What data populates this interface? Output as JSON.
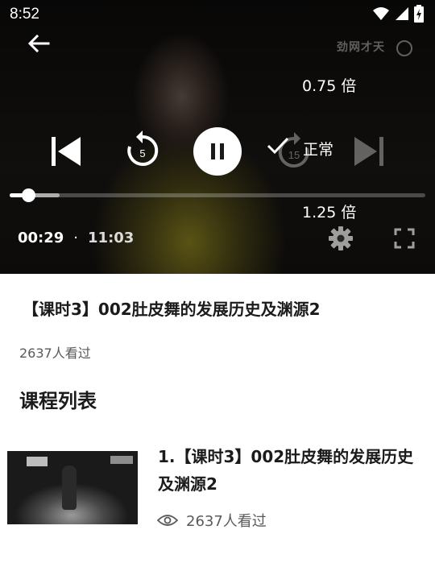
{
  "status_bar": {
    "time": "8:52"
  },
  "player": {
    "watermark": "劲网才天",
    "replay_seconds": "5",
    "forward_seconds": "15",
    "speed_options": [
      "0.75 倍",
      "正常",
      "1.25 倍"
    ],
    "speed_selected": "正常",
    "current_time": "00:29",
    "separator": "·",
    "total_time": "11:03",
    "progress_played": 0.044,
    "progress_buffered": 0.12
  },
  "lesson": {
    "title": "【课时3】002肚皮舞的发展历史及渊源2",
    "views": "2637人看过"
  },
  "course_list": {
    "heading": "课程列表",
    "items": [
      {
        "title": "1.【课时3】002肚皮舞的发展历史及渊源2",
        "views": "2637人看过"
      }
    ]
  }
}
